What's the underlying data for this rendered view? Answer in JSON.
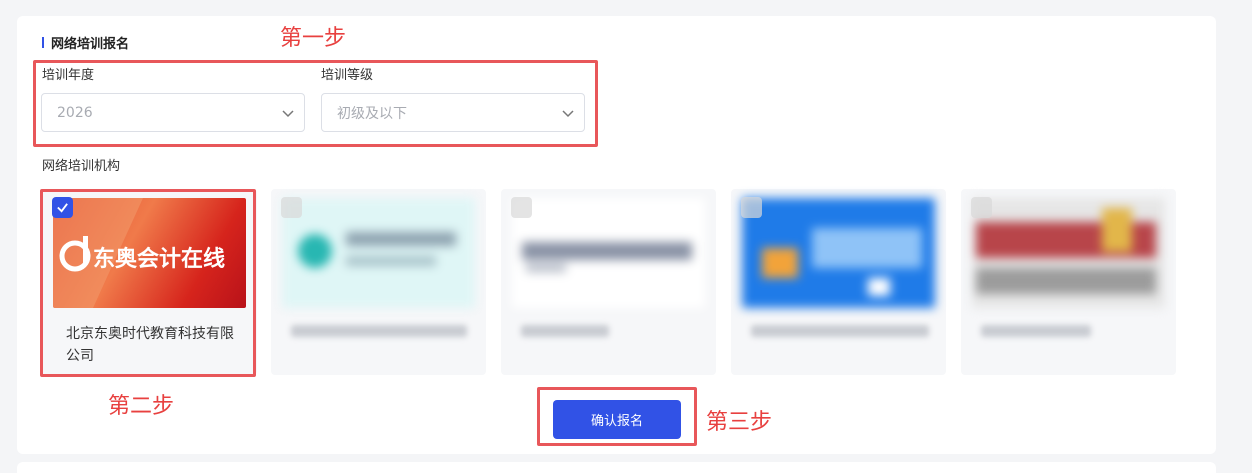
{
  "section": {
    "title": "网络培训报名"
  },
  "fields": {
    "year": {
      "label": "培训年度",
      "value": "2026"
    },
    "level": {
      "label": "培训等级",
      "value": "初级及以下"
    }
  },
  "institutions": {
    "label": "网络培训机构",
    "items": [
      {
        "name": "北京东奥时代教育科技有限公司",
        "logo_text": "东奥会计在线",
        "selected": true
      },
      {
        "name": "",
        "selected": false
      },
      {
        "name": "",
        "selected": false
      },
      {
        "name": "",
        "selected": false
      },
      {
        "name": "",
        "selected": false
      }
    ]
  },
  "confirm_button": "确认报名",
  "annotations": {
    "step1": "第一步",
    "step2": "第二步",
    "step3": "第三步"
  },
  "colors": {
    "accent": "#3152e6",
    "annotation": "#e8575a"
  }
}
